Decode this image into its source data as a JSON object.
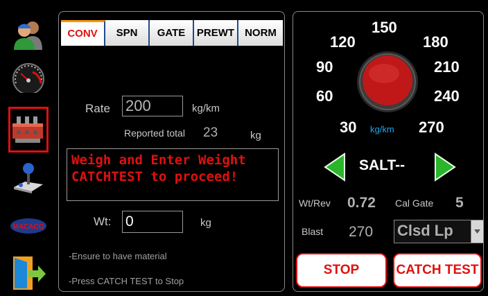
{
  "sidebar": {
    "items": [
      {
        "name": "users"
      },
      {
        "name": "speedometer"
      },
      {
        "name": "valves"
      },
      {
        "name": "joystick"
      },
      {
        "name": "macaco",
        "logo_text": "MACACO"
      },
      {
        "name": "exit"
      }
    ]
  },
  "tabs": [
    "CONV",
    "SPN",
    "GATE",
    "PREWT",
    "NORM"
  ],
  "calibration": {
    "rate_label": "Rate",
    "rate_value": "200",
    "rate_unit": "kg/km",
    "reported_total_label": "Reported total",
    "reported_total_value": "23",
    "reported_total_unit": "kg",
    "message": "Weigh and Enter Weight CATCHTEST to proceed!",
    "wt_label": "Wt:",
    "wt_value": "0",
    "wt_unit": "kg",
    "note1": "-Ensure to have material",
    "note2": "-Press CATCH TEST to Stop"
  },
  "dial": {
    "marks": [
      "30",
      "60",
      "90",
      "120",
      "150",
      "180",
      "210",
      "240",
      "270"
    ],
    "unit": "kg/km"
  },
  "material": {
    "name": "SALT--"
  },
  "stats": {
    "wt_rev_label": "Wt/Rev",
    "wt_rev_value": "0.72",
    "cal_gate_label": "Cal Gate",
    "cal_gate_value": "5",
    "blast_label": "Blast",
    "blast_value": "270",
    "mode_selected": "Clsd Lp"
  },
  "buttons": {
    "stop": "STOP",
    "catch_test": "CATCH TEST"
  },
  "colors": {
    "accent_red": "#e01010",
    "tab_orange": "#ff9800",
    "unit_blue": "#18a8f0",
    "arrow_green": "#2bb52b"
  }
}
